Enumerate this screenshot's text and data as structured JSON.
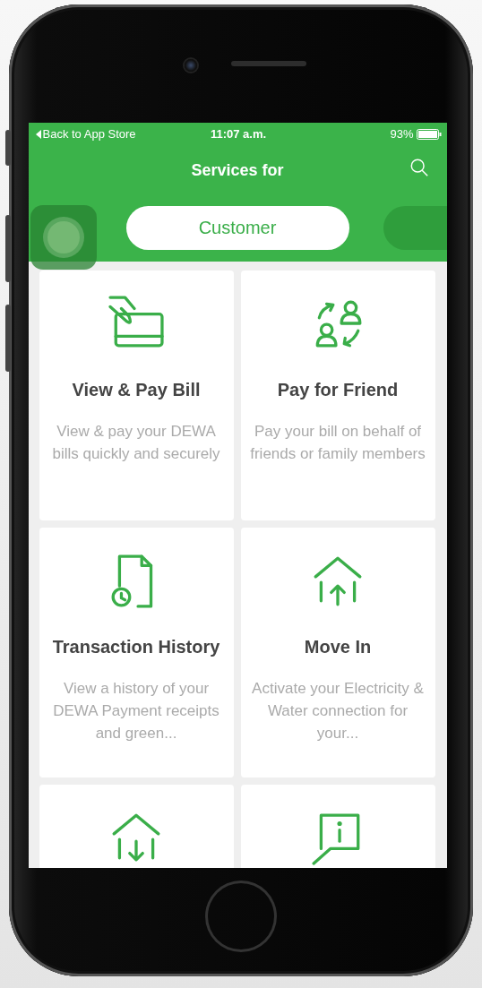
{
  "status_bar": {
    "back": "Back to App Store",
    "time": "11:07 a.m.",
    "battery": "93%"
  },
  "nav": {
    "title": "Services for"
  },
  "segments": [
    {
      "label": "Customer",
      "selected": true
    },
    {
      "selected": false
    }
  ],
  "tiles": [
    {
      "kind": "card",
      "title": "View & Pay Bill",
      "description": "View & pay your DEWA bills quickly and securely"
    },
    {
      "kind": "exchange",
      "title": "Pay for Friend",
      "description": "Pay your bill on behalf of friends or family members"
    },
    {
      "kind": "document-clock",
      "title": "Transaction History",
      "description": "View a history of your DEWA Payment receipts and green..."
    },
    {
      "kind": "house-up",
      "title": "Move In",
      "description": "Activate your Electricity & Water connection for your..."
    },
    {
      "kind": "house-down"
    },
    {
      "kind": "info-chat"
    }
  ]
}
